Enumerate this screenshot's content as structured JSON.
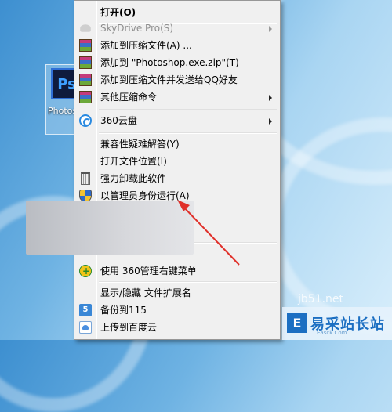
{
  "desktop": {
    "icon_label": "Photoshop.exe",
    "icon_glyph": "Ps"
  },
  "context_menu": {
    "items": [
      {
        "label": "打开(O)",
        "icon": "none",
        "bold": true,
        "submenu": false
      },
      {
        "label": "SkyDrive Pro(S)",
        "icon": "cloud-icon",
        "disabled": true,
        "submenu": true
      },
      {
        "label": "添加到压缩文件(A) ...",
        "icon": "winrar-icon",
        "submenu": false
      },
      {
        "label": "添加到 \"Photoshop.exe.zip\"(T)",
        "icon": "winrar-icon",
        "submenu": false
      },
      {
        "label": "添加到压缩文件并发送给QQ好友",
        "icon": "winrar-icon",
        "submenu": false
      },
      {
        "label": "其他压缩命令",
        "icon": "winrar-icon",
        "submenu": true
      },
      {
        "label": "360云盘",
        "icon": "360-cloud-icon",
        "submenu": true
      },
      {
        "label": "兼容性疑难解答(Y)",
        "icon": "none",
        "submenu": false
      },
      {
        "label": "打开文件位置(I)",
        "icon": "none",
        "submenu": false
      },
      {
        "label": "强力卸载此软件",
        "icon": "trash-icon",
        "submenu": false
      },
      {
        "label": "以管理员身份运行(A)",
        "icon": "uac-shield-icon",
        "submenu": false
      },
      {
        "label": "使用 360管理右键菜单",
        "icon": "360-manager-icon",
        "submenu": false
      },
      {
        "label": "显示/隐藏 文件扩展名",
        "icon": "none",
        "submenu": false
      },
      {
        "label": "备份到115",
        "icon": "115-icon",
        "submenu": false
      },
      {
        "label": "上传到百度云",
        "icon": "baidu-cloud-icon",
        "submenu": false
      }
    ]
  },
  "watermark": {
    "logo_glyph": "E",
    "brand": "易采站长站",
    "sub": "Easck.Com",
    "partial_url": "jb51.net"
  },
  "colors": {
    "annotation_arrow": "#e0302a",
    "menu_bg": "#f0f0f0",
    "brand_blue": "#1c6fc2"
  }
}
